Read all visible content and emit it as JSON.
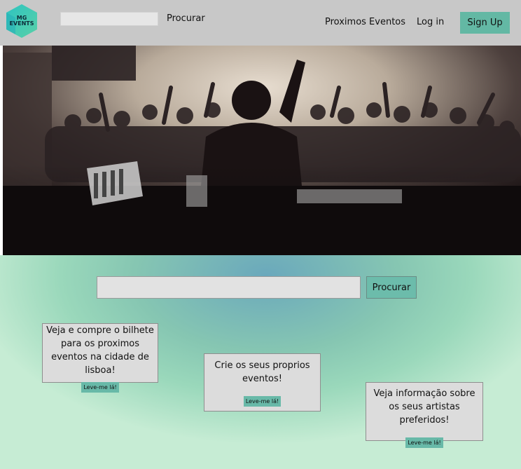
{
  "header": {
    "logo_text_line1": "MG",
    "logo_text_line2": "EVENTS",
    "search_button": "Procurar",
    "nav": {
      "events": "Proximos Eventos",
      "login": "Log in",
      "signup": "Sign Up"
    }
  },
  "main": {
    "search_button": "Procurar",
    "cards": [
      {
        "text": "Veja e compre o bilhete para os proximos eventos na cidade de lisboa!",
        "button": "Leve-me lá!"
      },
      {
        "text": "Crie os seus proprios eventos!",
        "button": "Leve-me lá!"
      },
      {
        "text": "Veja informação sobre os seus artistas preferidos!",
        "button": "Leve-me lá!"
      }
    ]
  },
  "colors": {
    "header_bg": "#c8c8c8",
    "accent": "#63b8a4",
    "logo_gradient": [
      "#2ec4c0",
      "#58d0a8"
    ]
  }
}
